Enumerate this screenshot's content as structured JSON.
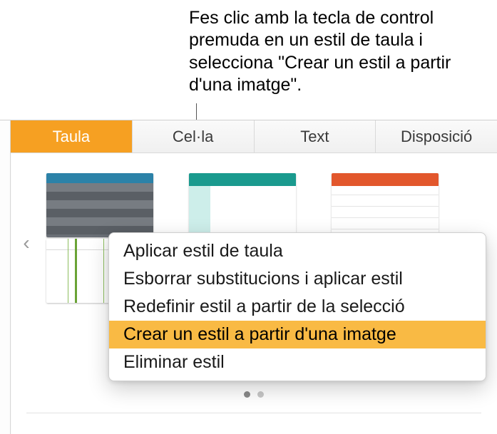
{
  "callout": {
    "text": "Fes clic amb la tecla de control premuda en un estil de taula i selecciona \"Crear un estil a partir d'una imatge\"."
  },
  "tabs": {
    "table": "Taula",
    "cell": "Cel·la",
    "text": "Text",
    "layout": "Disposició"
  },
  "nav": {
    "prev_glyph": "‹"
  },
  "menu": {
    "apply": "Aplicar estil de taula",
    "clear": "Esborrar substitucions i aplicar estil",
    "redefine": "Redefinir estil a partir de la selecció",
    "create_from_image": "Crear un estil a partir d'una imatge",
    "delete": "Eliminar estil"
  }
}
